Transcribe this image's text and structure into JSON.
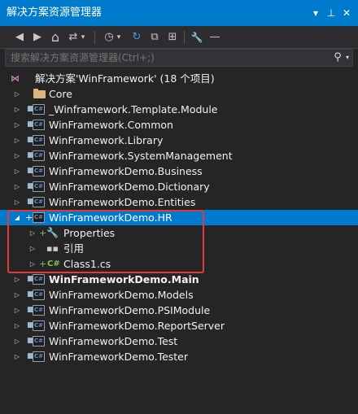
{
  "window": {
    "title": "解决方案资源管理器",
    "dropdown_glyph": "▾",
    "pin_glyph": "⊥",
    "close_glyph": "✕"
  },
  "toolbar": {
    "back": "◀",
    "forward": "▶",
    "home": "⌂",
    "switch_views": "⇄",
    "switch_views_drop": "▾",
    "history": "◷",
    "history_drop": "▾",
    "refresh": "↻",
    "collapse_all": "⧉",
    "show_all": "⊞",
    "properties": "🔧",
    "preview": "—"
  },
  "search": {
    "placeholder": "搜索解决方案资源管理器(Ctrl+;)",
    "icon": "⚲",
    "drop": "▾"
  },
  "tree": {
    "solution": {
      "label": "解决方案'WinFramework' (18 个项目)"
    },
    "items": [
      {
        "label": "Core",
        "type": "folder"
      },
      {
        "label": "_Winframework.Template.Module",
        "type": "project"
      },
      {
        "label": "WinFramework.Common",
        "type": "project"
      },
      {
        "label": "WinFramework.Library",
        "type": "project"
      },
      {
        "label": "WinFramework.SystemManagement",
        "type": "project"
      },
      {
        "label": "WinFrameworkDemo.Business",
        "type": "project"
      },
      {
        "label": "WinFrameworkDemo.Dictionary",
        "type": "project"
      },
      {
        "label": "WinFrameworkDemo.Entities",
        "type": "project"
      },
      {
        "label": "WinFrameworkDemo.HR",
        "type": "project",
        "expanded": true,
        "selected": true
      },
      {
        "label": "Properties",
        "type": "properties"
      },
      {
        "label": "引用",
        "type": "references"
      },
      {
        "label": "Class1.cs",
        "type": "csfile"
      },
      {
        "label": "WinFrameworkDemo.Main",
        "type": "project",
        "bold": true
      },
      {
        "label": "WinFrameworkDemo.Models",
        "type": "project"
      },
      {
        "label": "WinFrameworkDemo.PSIModule",
        "type": "project"
      },
      {
        "label": "WinFrameworkDemo.ReportServer",
        "type": "project"
      },
      {
        "label": "WinFrameworkDemo.Test",
        "type": "project"
      },
      {
        "label": "WinFrameworkDemo.Tester",
        "type": "project"
      }
    ]
  },
  "icons": {
    "collapsed": "▷",
    "expanded": "◢",
    "lock": "🔒",
    "cs_project": "C#",
    "cs_file": "C#",
    "plus": "+",
    "sln": "⋈",
    "wrench": "🔧",
    "refs": "▪▪"
  },
  "colors": {
    "accent": "#007acc",
    "background": "#252526",
    "highlight_box": "#e03a3a"
  }
}
